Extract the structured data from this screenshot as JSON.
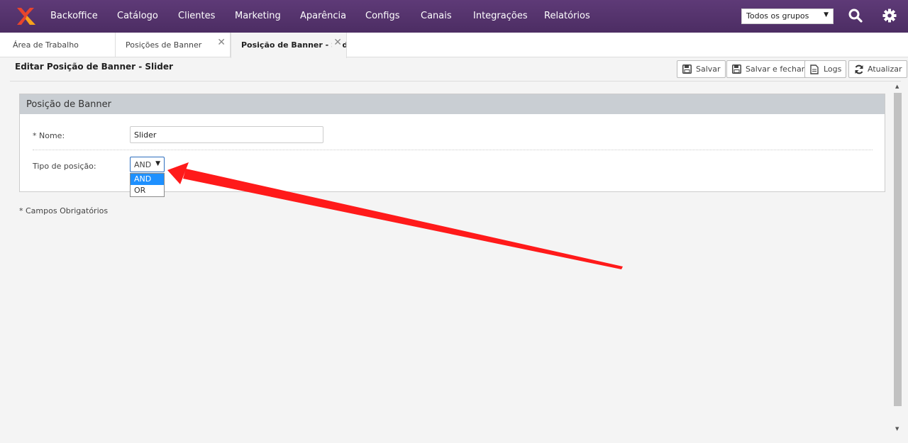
{
  "navbar": {
    "items": [
      "Backoffice",
      "Catálogo",
      "Clientes",
      "Marketing",
      "Aparência",
      "Configs",
      "Canais",
      "Integrações",
      "Relatórios"
    ],
    "group_select": "Todos os grupos",
    "icons": [
      "search-icon",
      "gear-icon"
    ]
  },
  "tabs": [
    {
      "label": "Área de Trabalho",
      "closable": false
    },
    {
      "label": "Posições de Banner",
      "closable": true
    },
    {
      "label": "Posição de Banner - Slid",
      "closable": true,
      "active": true
    }
  ],
  "page": {
    "title": "Editar Posição de Banner - Slider",
    "buttons": {
      "save": "Salvar",
      "save_close": "Salvar e fechar",
      "logs": "Logs",
      "refresh": "Atualizar"
    }
  },
  "panel": {
    "title": "Posição de Banner",
    "name_label": "* Nome:",
    "name_value": "Slider",
    "type_label": "Tipo de posição:",
    "type_value": "AND",
    "type_options": [
      "AND",
      "OR"
    ]
  },
  "required_note": "* Campos Obrigatórios",
  "colors": {
    "navbar": "#5e3a77",
    "accent": "#1e90ff",
    "annotation_arrow": "#ff0000"
  }
}
